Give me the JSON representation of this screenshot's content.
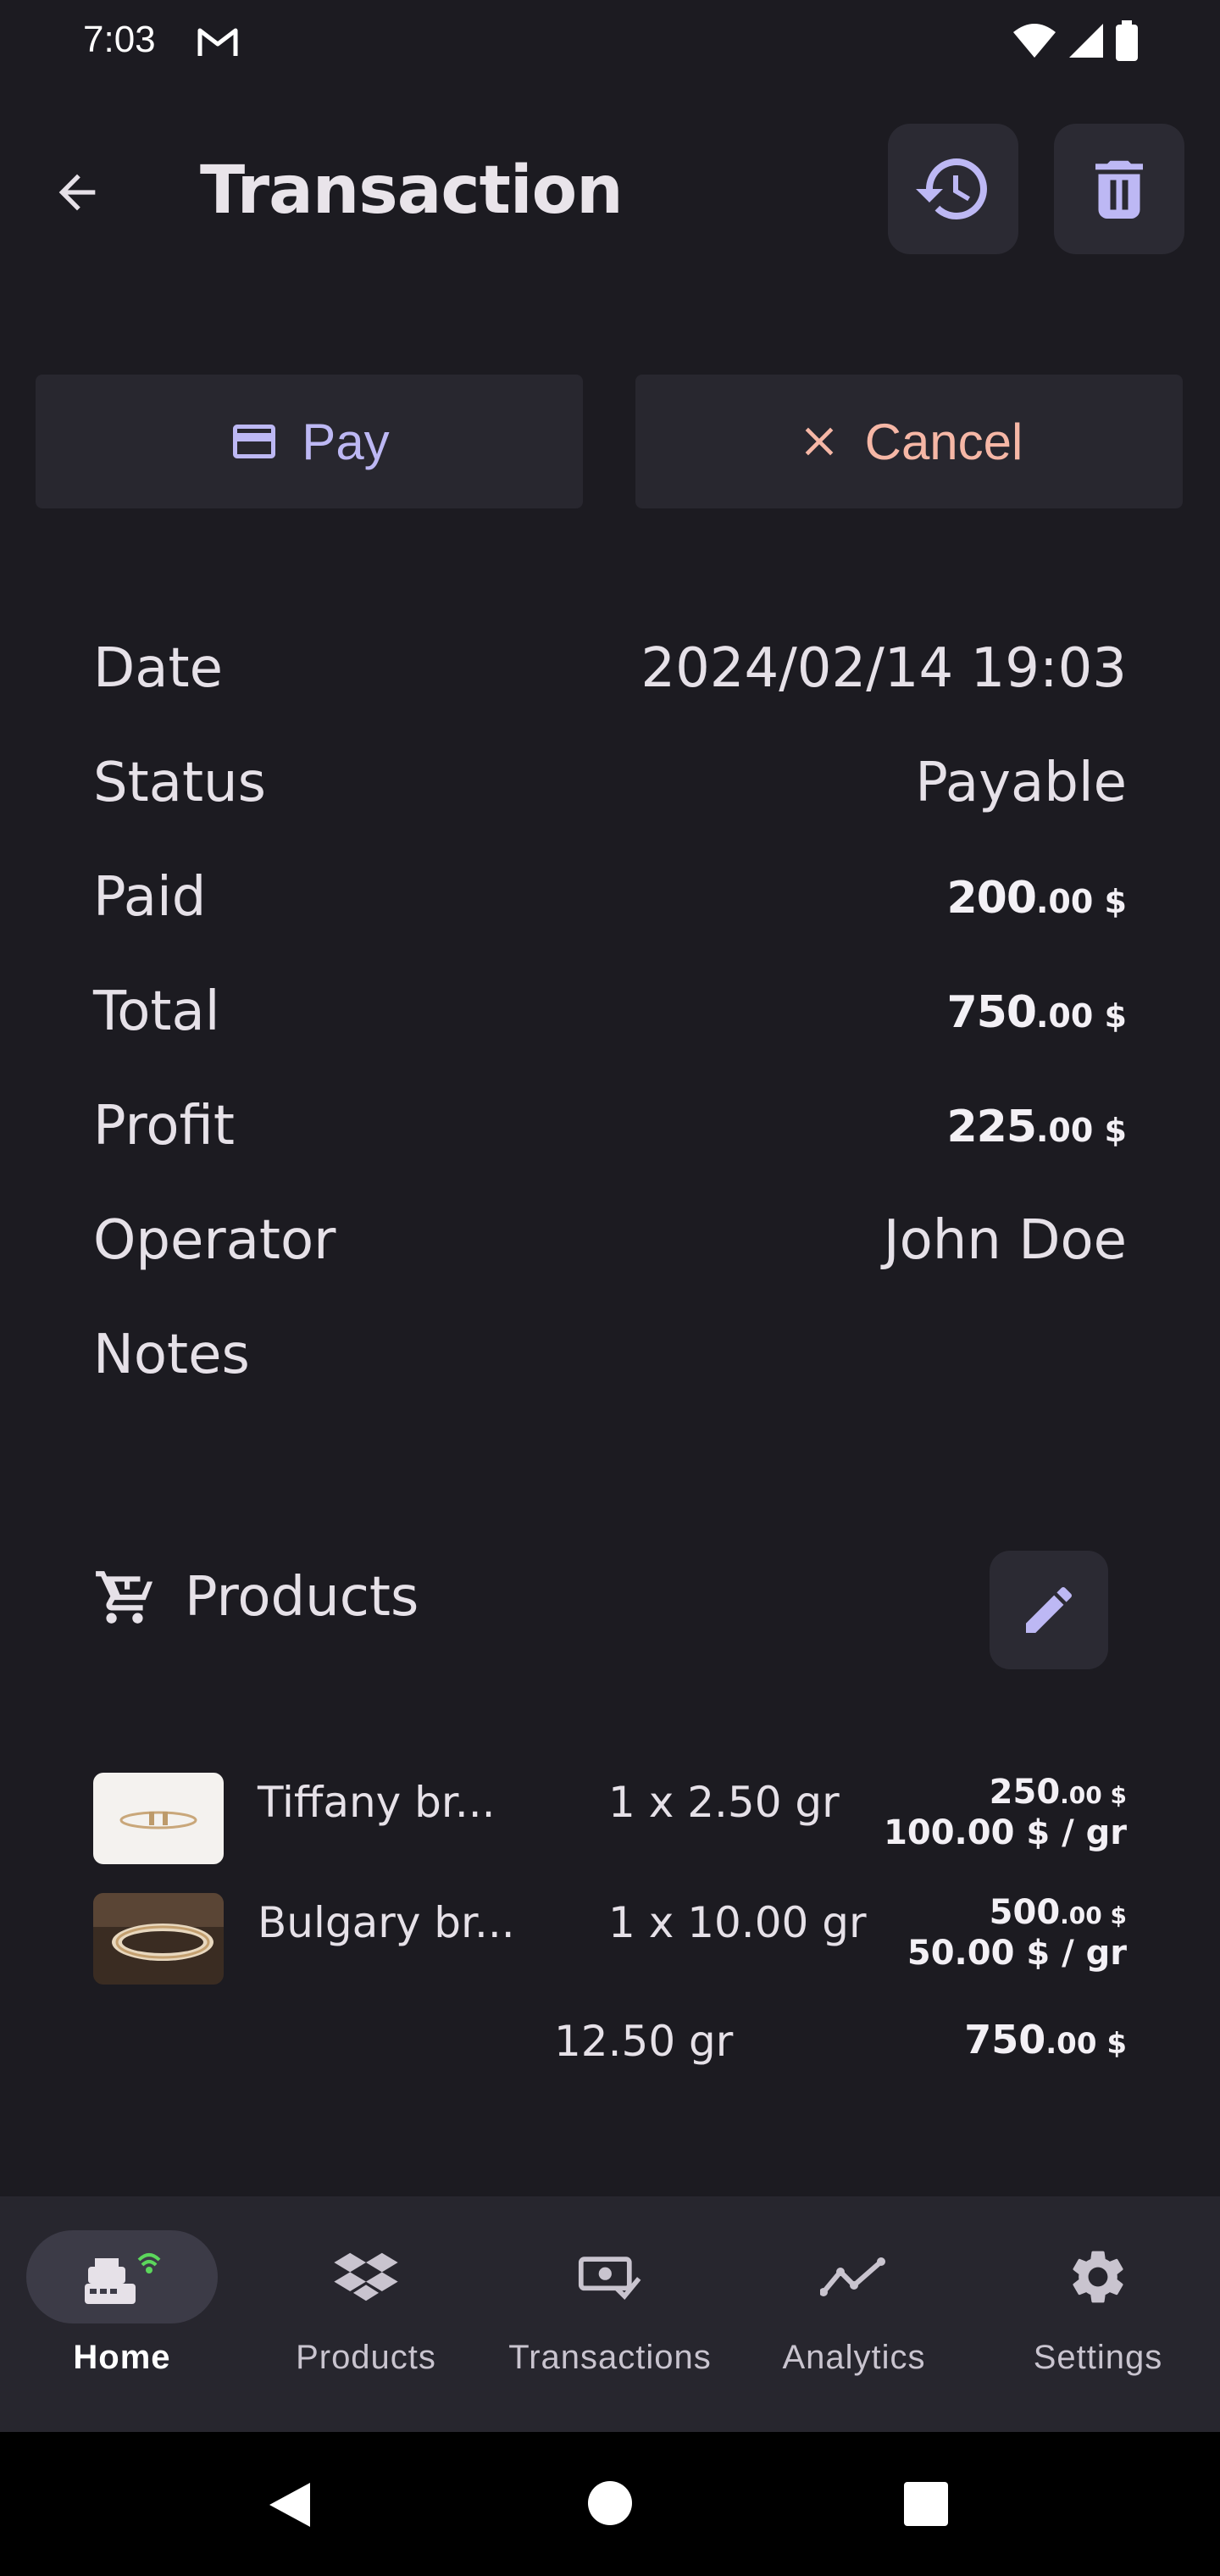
{
  "status_bar": {
    "time": "7:03"
  },
  "app_bar": {
    "title": "Transaction"
  },
  "actions": {
    "pay_label": "Pay",
    "cancel_label": "Cancel"
  },
  "details": {
    "date_label": "Date",
    "date_value": "2024/02/14 19:03",
    "status_label": "Status",
    "status_value": "Payable",
    "paid_label": "Paid",
    "paid_int": "200",
    "paid_dec": ".00 $",
    "total_label": "Total",
    "total_int": "750",
    "total_dec": ".00 $",
    "profit_label": "Profit",
    "profit_int": "225",
    "profit_dec": ".00 $",
    "operator_label": "Operator",
    "operator_value": "John Doe",
    "notes_label": "Notes"
  },
  "products": {
    "title": "Products",
    "items": [
      {
        "name": "Tiffany br...",
        "qty": "1 x 2.50 gr",
        "price_int": "250",
        "price_dec": ".00 $",
        "unit_price": "100.00 $ / gr"
      },
      {
        "name": "Bulgary br...",
        "qty": "1 x 10.00 gr",
        "price_int": "500",
        "price_dec": ".00 $",
        "unit_price": "50.00 $ / gr"
      }
    ],
    "total_weight": "12.50 gr",
    "total_int": "750",
    "total_dec": ".00 $"
  },
  "bottom_nav": {
    "items": [
      {
        "label": "Home",
        "icon": "cash-register-icon",
        "active": true
      },
      {
        "label": "Products",
        "icon": "dropbox-icon"
      },
      {
        "label": "Transactions",
        "icon": "money-check-icon"
      },
      {
        "label": "Analytics",
        "icon": "trend-line-icon"
      },
      {
        "label": "Settings",
        "icon": "gear-icon"
      }
    ]
  },
  "colors": {
    "background": "#1c1b21",
    "surface": "#28272f",
    "pay_accent": "#bdb8f4",
    "cancel_accent": "#f6b7a6",
    "nav_active_pill": "#3c3b47"
  }
}
